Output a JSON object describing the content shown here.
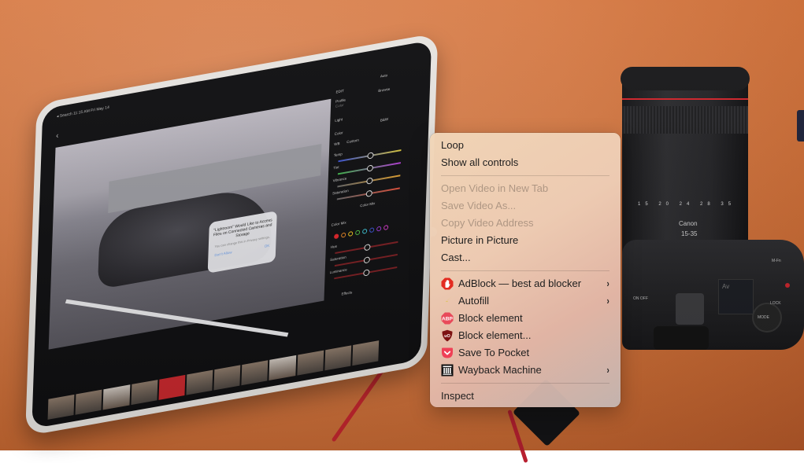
{
  "background": {
    "tablet": {
      "status_bar": "◂ Search  11:15 AM  Fri May 14",
      "back_label": "‹",
      "panel": {
        "edit": "EDIT",
        "auto": "Auto",
        "profile": "Profile",
        "profile_value": "Color",
        "browse": "Browse",
        "light": "Light",
        "color": "Color",
        "bw": "B&W",
        "wb_label": "WB",
        "wb_value": "Custom",
        "sliders": [
          "Temp",
          "Tint",
          "Vibrance",
          "Saturation"
        ],
        "color_mix_button": "Color Mix",
        "color_mix_label": "Color Mix",
        "mix_sliders": [
          "Hue",
          "Saturation",
          "Luminance"
        ],
        "effects": "Effects",
        "swatch_colors": [
          "#e0242a",
          "#f08a24",
          "#f2c81e",
          "#4fbf44",
          "#3ec6d8",
          "#3a54d6",
          "#9b3ad6",
          "#d63ac9"
        ]
      },
      "dialog": {
        "title": "“Lightroom” Would Like to Access Files on Connected Cameras and Storage",
        "subtitle": "You can change this in Privacy settings.",
        "deny": "Don't Allow",
        "ok": "OK"
      }
    },
    "camera": {
      "lens_scale": "15 20 24 28 35",
      "lens_brand": "Canon",
      "lens_focal": "15-35",
      "lcd_mode": "Av",
      "labels": [
        "ON OFF",
        "MODE",
        "LOCK",
        "M-Fn"
      ]
    }
  },
  "context_menu": {
    "groups": [
      [
        {
          "label": "Loop",
          "enabled": true
        },
        {
          "label": "Show all controls",
          "enabled": true
        }
      ],
      [
        {
          "label": "Open Video in New Tab",
          "enabled": false
        },
        {
          "label": "Save Video As...",
          "enabled": false
        },
        {
          "label": "Copy Video Address",
          "enabled": false
        },
        {
          "label": "Picture in Picture",
          "enabled": true
        },
        {
          "label": "Cast...",
          "enabled": true
        }
      ],
      [
        {
          "label": "AdBlock — best ad blocker",
          "icon": "adblock-hand-icon",
          "submenu": true
        },
        {
          "label": "Autofill",
          "icon": "autofill-lightning-icon",
          "submenu": true
        },
        {
          "label": "Block element",
          "icon": "abp-icon",
          "submenu": false
        },
        {
          "label": "Block element...",
          "icon": "ublock-origin-icon",
          "submenu": false
        },
        {
          "label": "Save To Pocket",
          "icon": "pocket-icon",
          "submenu": false
        },
        {
          "label": "Wayback Machine",
          "icon": "wayback-machine-icon",
          "submenu": true
        }
      ],
      [
        {
          "label": "Inspect",
          "enabled": true
        }
      ]
    ],
    "chevron": "›",
    "icon_text": {
      "abp": "ABP",
      "ublock": "uO"
    },
    "colors": {
      "adblock": "#e32b20",
      "autofill": "#d8c22a",
      "abp": "#e84a5a",
      "ublock": "#7d1212",
      "pocket": "#ef4056",
      "wayback": "#111111"
    }
  }
}
